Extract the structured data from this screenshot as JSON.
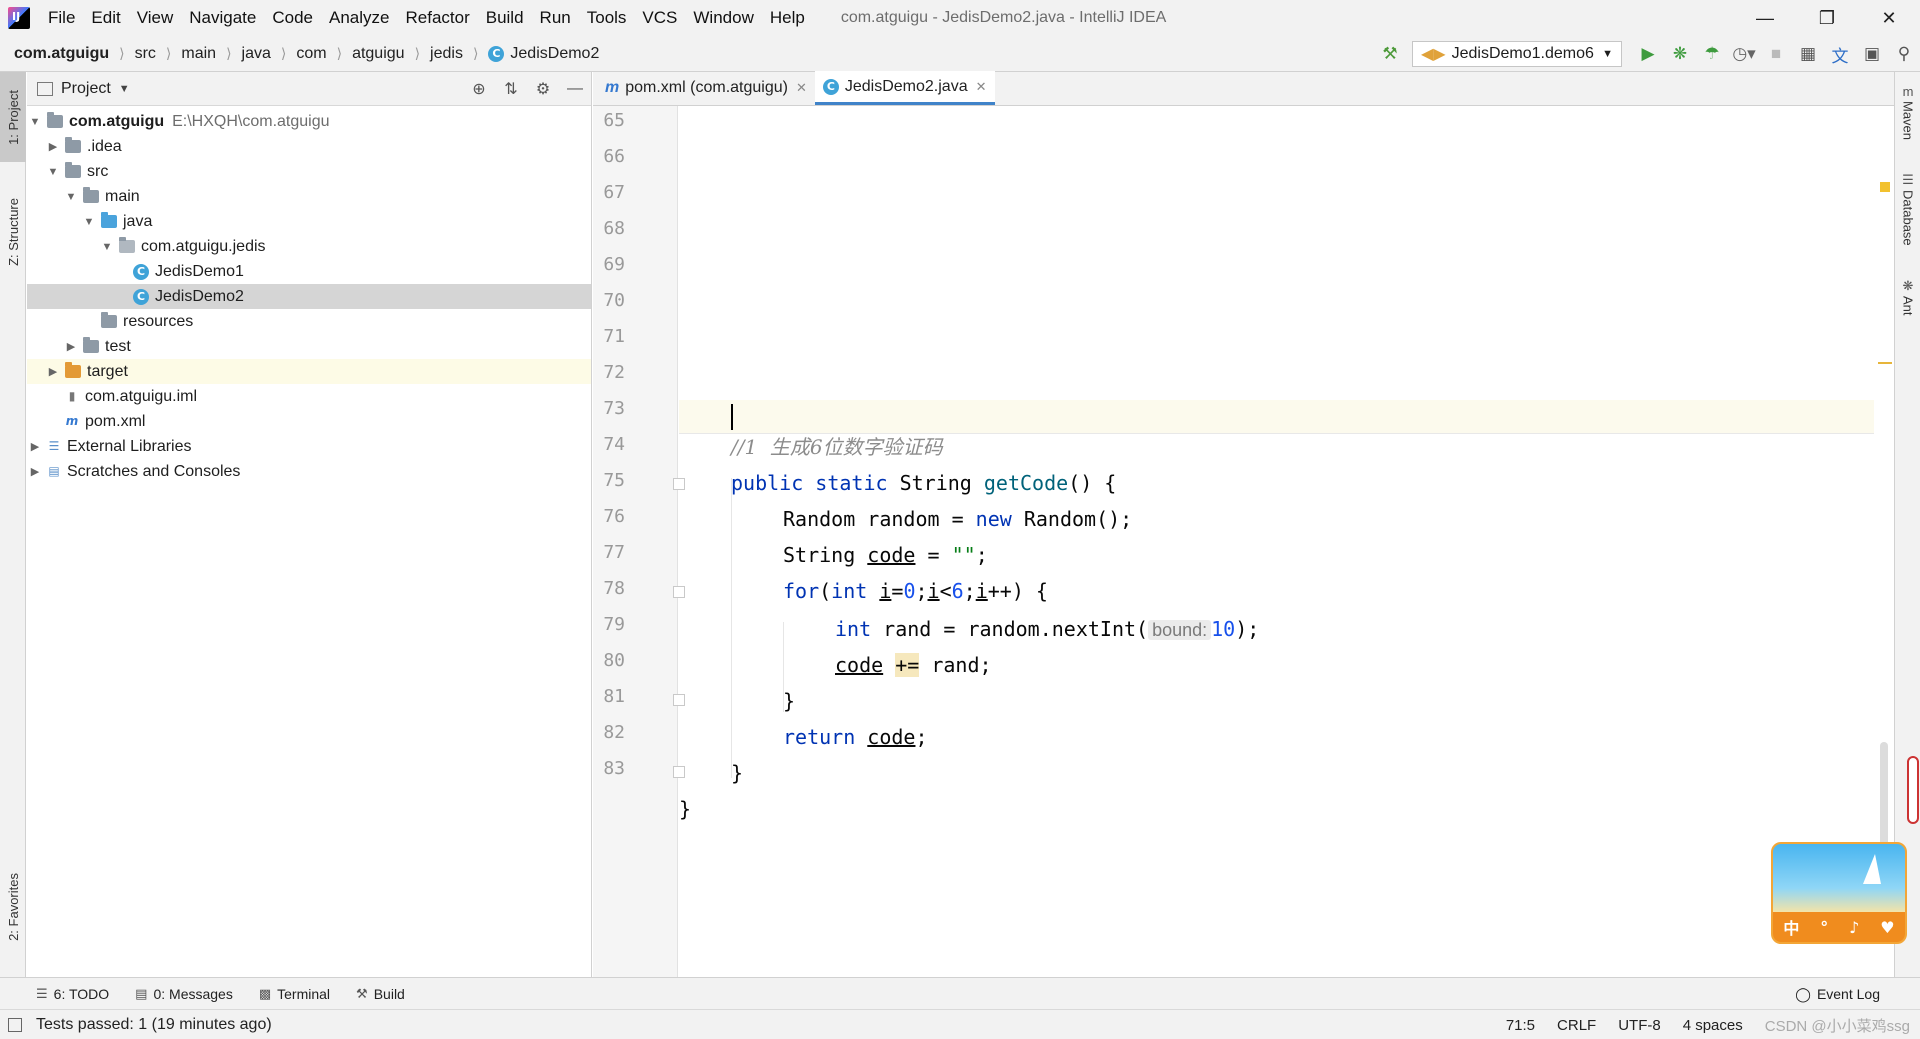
{
  "menubar": {
    "items": [
      "File",
      "Edit",
      "View",
      "Navigate",
      "Code",
      "Analyze",
      "Refactor",
      "Build",
      "Run",
      "Tools",
      "VCS",
      "Window",
      "Help"
    ],
    "title": "com.atguigu - JedisDemo2.java - IntelliJ IDEA"
  },
  "breadcrumb": [
    "com.atguigu",
    "src",
    "main",
    "java",
    "com",
    "atguigu",
    "jedis",
    "JedisDemo2"
  ],
  "run_config": "JedisDemo1.demo6",
  "left_strip": {
    "project": "1: Project",
    "structure": "Z: Structure",
    "favorites": "2: Favorites"
  },
  "right_strip": {
    "maven": "Maven",
    "database": "Database",
    "ant": "Ant"
  },
  "project_panel": {
    "title": "Project",
    "tree": [
      {
        "label": "com.atguigu",
        "hint": "E:\\HXQH\\com.atguigu"
      },
      {
        "label": ".idea"
      },
      {
        "label": "src"
      },
      {
        "label": "main"
      },
      {
        "label": "java"
      },
      {
        "label": "com.atguigu.jedis"
      },
      {
        "label": "JedisDemo1"
      },
      {
        "label": "JedisDemo2"
      },
      {
        "label": "resources"
      },
      {
        "label": "test"
      },
      {
        "label": "target"
      },
      {
        "label": "com.atguigu.iml"
      },
      {
        "label": "pom.xml"
      },
      {
        "label": "External Libraries"
      },
      {
        "label": "Scratches and Consoles"
      }
    ]
  },
  "editor": {
    "tabs": [
      "pom.xml (com.atguigu)",
      "JedisDemo2.java"
    ],
    "line_numbers": [
      "65",
      "66",
      "67",
      "68",
      "69",
      "70",
      "71",
      "72",
      "73",
      "74",
      "75",
      "76",
      "77",
      "78",
      "79",
      "80",
      "81",
      "82",
      "83"
    ],
    "code": {
      "l72": "//1  生成6位数字验证码",
      "public": "public",
      "static": "static",
      "String": "String",
      "getCode": "getCode",
      "sig_end": "() {",
      "l74a": "Random random = ",
      "new": "new",
      "l74b": " Random();",
      "l75a": "String ",
      "code": "code",
      "l75b": " = ",
      "empty_str": "\"\"",
      "semi": ";",
      "for": "for",
      "paren_open": "(",
      "int": "int",
      "space": " ",
      "i": "i",
      "eq": "=",
      "zero": "0",
      "lt": "<",
      "six": "6",
      "pp": "++) {",
      "l77a": " rand = random.nextInt(",
      "bound_hint": "bound:",
      "ten": "10",
      "l77b": ");",
      "pluseq": "+=",
      "l78b": " rand;",
      "close_brace": "}",
      "return": "return",
      "return_tail": ";"
    }
  },
  "sticker": {
    "glyphs": [
      "中",
      "°",
      "♪",
      "♥"
    ]
  },
  "bottom_tools": {
    "todo": "6: TODO",
    "messages": "0: Messages",
    "terminal": "Terminal",
    "build": "Build",
    "event_log": "Event Log"
  },
  "status": {
    "text": "Tests passed: 1 (19 minutes ago)",
    "position": "71:5",
    "line_sep": "CRLF",
    "encoding": "UTF-8",
    "indent": "4 spaces",
    "watermark": "CSDN @小小菜鸡ssg"
  }
}
